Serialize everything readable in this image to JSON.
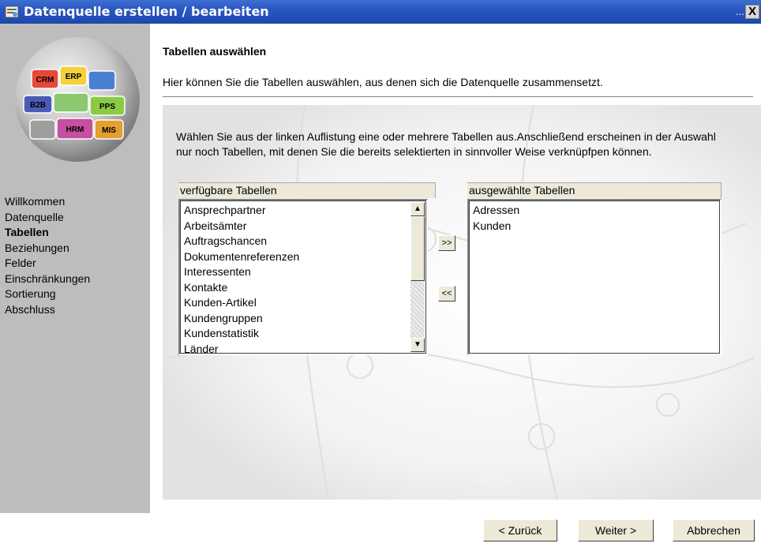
{
  "window": {
    "title": "Datenquelle erstellen / bearbeiten",
    "title_dots": "...",
    "close_label": "X"
  },
  "logo": {
    "labels": [
      "CRM",
      "ERP",
      "B2B",
      "PPS",
      "HRM",
      "MIS"
    ]
  },
  "nav": {
    "items": [
      "Willkommen",
      "Datenquelle",
      "Tabellen",
      "Beziehungen",
      "Felder",
      "Einschränkungen",
      "Sortierung",
      "Abschluss"
    ],
    "active": "Tabellen"
  },
  "main": {
    "section_title": "Tabellen auswählen",
    "section_desc": "Hier können Sie die Tabellen auswählen, aus denen sich die Datenquelle zusammensetzt.",
    "instructions": "Wählen Sie aus der linken Auflistung eine oder mehrere Tabellen aus.Anschließend erscheinen in der Auswahl nur noch Tabellen, mit denen Sie die bereits selektierten in sinnvoller Weise verknüpfpen können."
  },
  "available": {
    "label": "verfügbare Tabellen",
    "items": [
      "Ansprechpartner",
      "Arbeitsämter",
      "Auftragschancen",
      "Dokumentenreferenzen",
      "Interessenten",
      "Kontakte",
      "Kunden-Artikel",
      "Kundengruppen",
      "Kundenstatistik",
      "Länder"
    ]
  },
  "selected": {
    "label": "ausgewählte Tabellen",
    "items": [
      "Adressen",
      "Kunden"
    ]
  },
  "move": {
    "add_label": ">>",
    "remove_label": "<<"
  },
  "buttons": {
    "back": "< Zurück",
    "next": "Weiter >",
    "cancel": "Abbrechen"
  },
  "colors": {
    "titlebar": "#2a56c2",
    "sidebar": "#bdbdbd",
    "button_face": "#ece9d8"
  }
}
